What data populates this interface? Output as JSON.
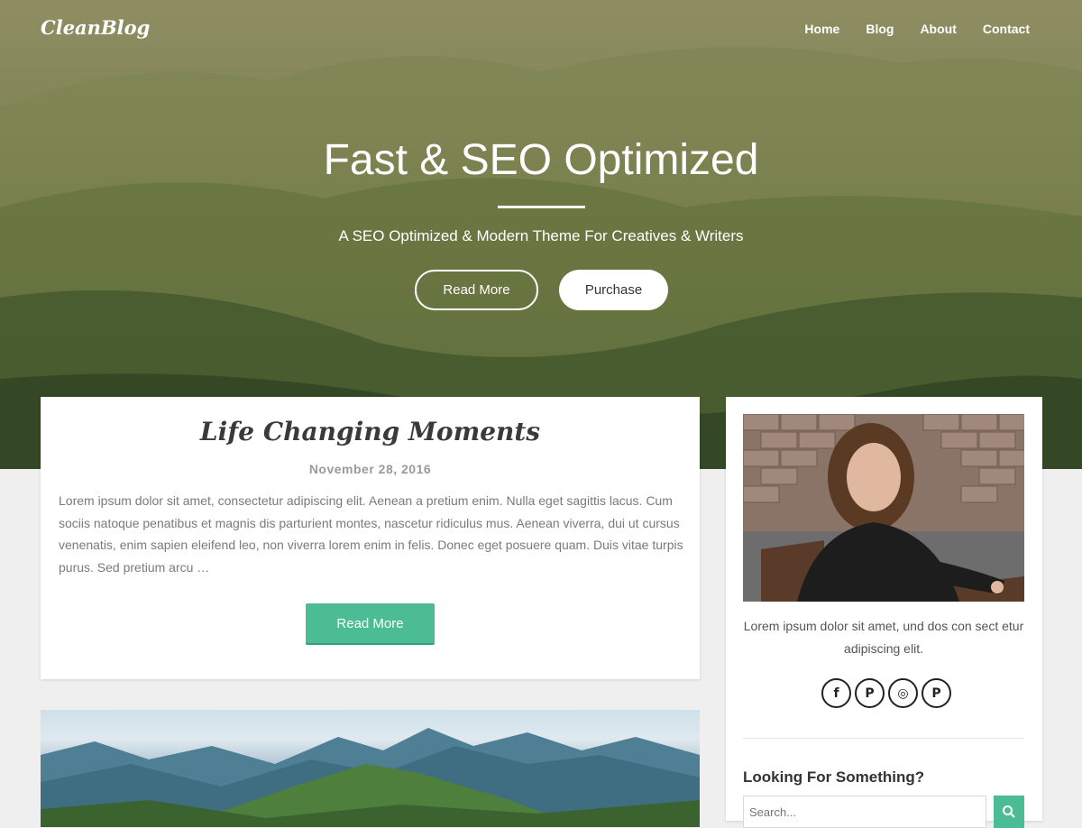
{
  "header": {
    "brand": "CleanBlog",
    "nav": [
      "Home",
      "Blog",
      "About",
      "Contact"
    ]
  },
  "hero": {
    "title": "Fast & SEO Optimized",
    "subtitle": "A SEO Optimized & Modern Theme For Creatives & Writers",
    "read_more_label": "Read More",
    "purchase_label": "Purchase"
  },
  "post": {
    "title": "Life Changing Moments",
    "date": "November 28, 2016",
    "excerpt": "Lorem ipsum dolor sit amet, consectetur adipiscing elit. Aenean a pretium enim. Nulla eget sagittis lacus. Cum sociis natoque penatibus et magnis dis parturient montes, nascetur ridiculus mus. Aenean viverra, dui ut cursus venenatis, enim sapien eleifend leo, non viverra lorem enim in felis. Donec eget posuere quam. Duis vitae turpis purus. Sed pretium arcu …",
    "read_more_label": "Read More"
  },
  "sidebar": {
    "bio": "Lorem ipsum dolor sit amet, und dos con sect etur adipiscing elit.",
    "socials": [
      {
        "name": "facebook",
        "glyph": "f"
      },
      {
        "name": "pinterest",
        "glyph": "P"
      },
      {
        "name": "instagram",
        "glyph": "◎"
      },
      {
        "name": "pinterest",
        "glyph": "P"
      }
    ],
    "search_title": "Looking For Something?",
    "search_placeholder": "Search..."
  },
  "colors": {
    "accent": "#4cbc94",
    "page_bg": "#efefef"
  }
}
